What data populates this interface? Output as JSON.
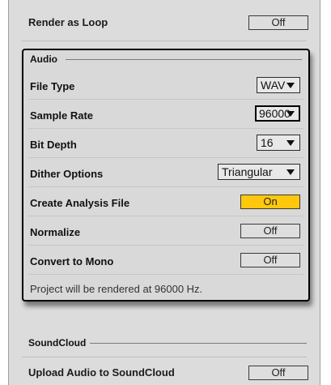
{
  "render_loop": {
    "label": "Render as Loop",
    "value": "Off"
  },
  "audio": {
    "title": "Audio",
    "file_type": {
      "label": "File Type",
      "value": "WAV"
    },
    "sample_rate": {
      "label": "Sample Rate",
      "value": "96000"
    },
    "bit_depth": {
      "label": "Bit Depth",
      "value": "16"
    },
    "dither": {
      "label": "Dither Options",
      "value": "Triangular"
    },
    "analysis": {
      "label": "Create Analysis File",
      "value": "On"
    },
    "normalize": {
      "label": "Normalize",
      "value": "Off"
    },
    "mono": {
      "label": "Convert to Mono",
      "value": "Off"
    },
    "note": "Project will be rendered at 96000 Hz."
  },
  "soundcloud": {
    "title": "SoundCloud",
    "upload": {
      "label": "Upload Audio to SoundCloud",
      "value": "Off"
    }
  },
  "colors": {
    "on": "#ffc80d",
    "panel": "#dcdcdc"
  }
}
